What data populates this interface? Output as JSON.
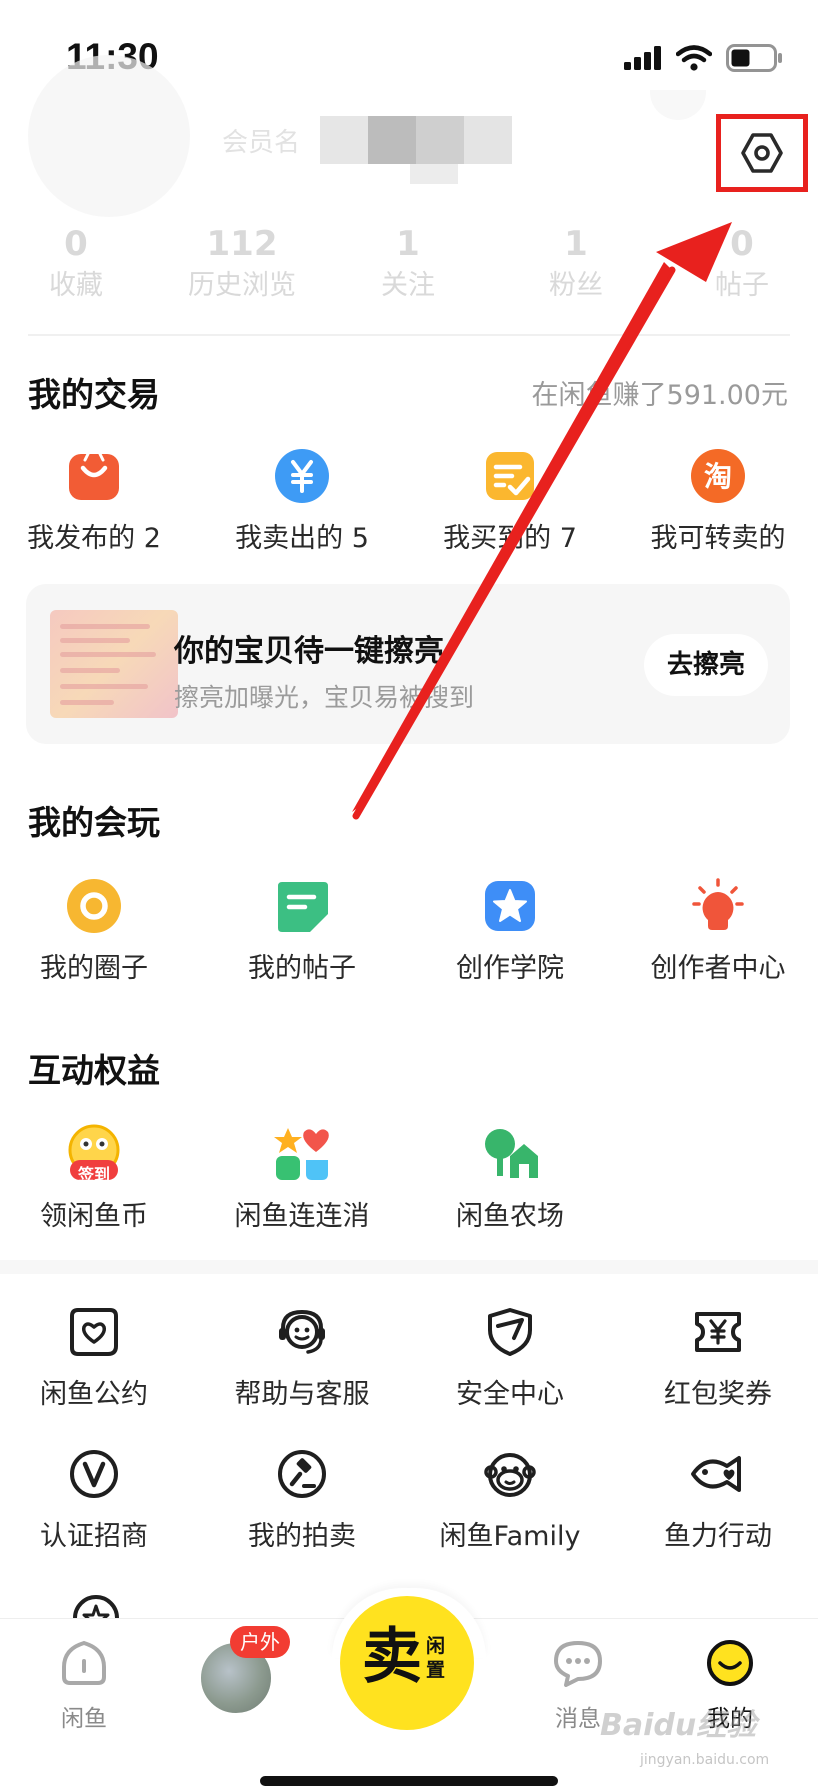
{
  "status_bar": {
    "time": "11:30"
  },
  "profile": {
    "nickname_hint": "会员名",
    "stats": [
      {
        "value": "0",
        "label": "收藏"
      },
      {
        "value": "112",
        "label": "历史浏览"
      },
      {
        "value": "1",
        "label": "关注"
      },
      {
        "value": "1",
        "label": "粉丝"
      },
      {
        "value": "0",
        "label": "帖子"
      }
    ]
  },
  "trade": {
    "title": "我的交易",
    "earned": "在闲鱼赚了591.00元",
    "items": [
      {
        "label": "我发布的 2",
        "icon": "shopping-bag-icon",
        "color": "#f25c35"
      },
      {
        "label": "我卖出的 5",
        "icon": "yuan-coin-icon",
        "color": "#3e9bf5"
      },
      {
        "label": "我买到的 7",
        "icon": "order-check-icon",
        "color": "#fbb72f"
      },
      {
        "label": "我可转卖的",
        "icon": "taobao-icon",
        "color": "#f46a26"
      }
    ]
  },
  "promo": {
    "title": "你的宝贝待一键擦亮",
    "subtitle": "擦亮加曝光，宝贝易被搜到",
    "button": "去擦亮"
  },
  "play": {
    "title": "我的会玩",
    "items": [
      {
        "label": "我的圈子",
        "icon": "circle-icon",
        "color": "#f7b731"
      },
      {
        "label": "我的帖子",
        "icon": "post-icon",
        "color": "#3cbf83"
      },
      {
        "label": "创作学院",
        "icon": "star-badge-icon",
        "color": "#3e8ef7"
      },
      {
        "label": "创作者中心",
        "icon": "lightbulb-icon",
        "color": "#f0553a"
      }
    ]
  },
  "benefits": {
    "title": "互动权益",
    "sign_badge": "签到",
    "items": [
      {
        "label": "领闲鱼币",
        "icon": "sign-in-coin-icon"
      },
      {
        "label": "闲鱼连连消",
        "icon": "puzzle-game-icon"
      },
      {
        "label": "闲鱼农场",
        "icon": "farm-icon"
      }
    ]
  },
  "services": {
    "items": [
      {
        "label": "闲鱼公约",
        "icon": "convention-icon"
      },
      {
        "label": "帮助与客服",
        "icon": "customer-service-icon"
      },
      {
        "label": "安全中心",
        "icon": "shield-icon"
      },
      {
        "label": "红包奖券",
        "icon": "coupon-icon"
      },
      {
        "label": "认证招商",
        "icon": "verified-icon"
      },
      {
        "label": "我的拍卖",
        "icon": "auction-hammer-icon"
      },
      {
        "label": "闲鱼Family",
        "icon": "family-monkey-icon"
      },
      {
        "label": "鱼力行动",
        "icon": "fish-heart-icon"
      }
    ]
  },
  "tabbar": {
    "home": "闲鱼",
    "outdoor_badge": "户外",
    "sell_main": "卖",
    "sell_sub": "闲置",
    "messages": "消息",
    "mine": "我的",
    "accent": "#ffe21f"
  },
  "watermark": {
    "brand": "Baidu经验",
    "url": "jingyan.baidu.com"
  }
}
